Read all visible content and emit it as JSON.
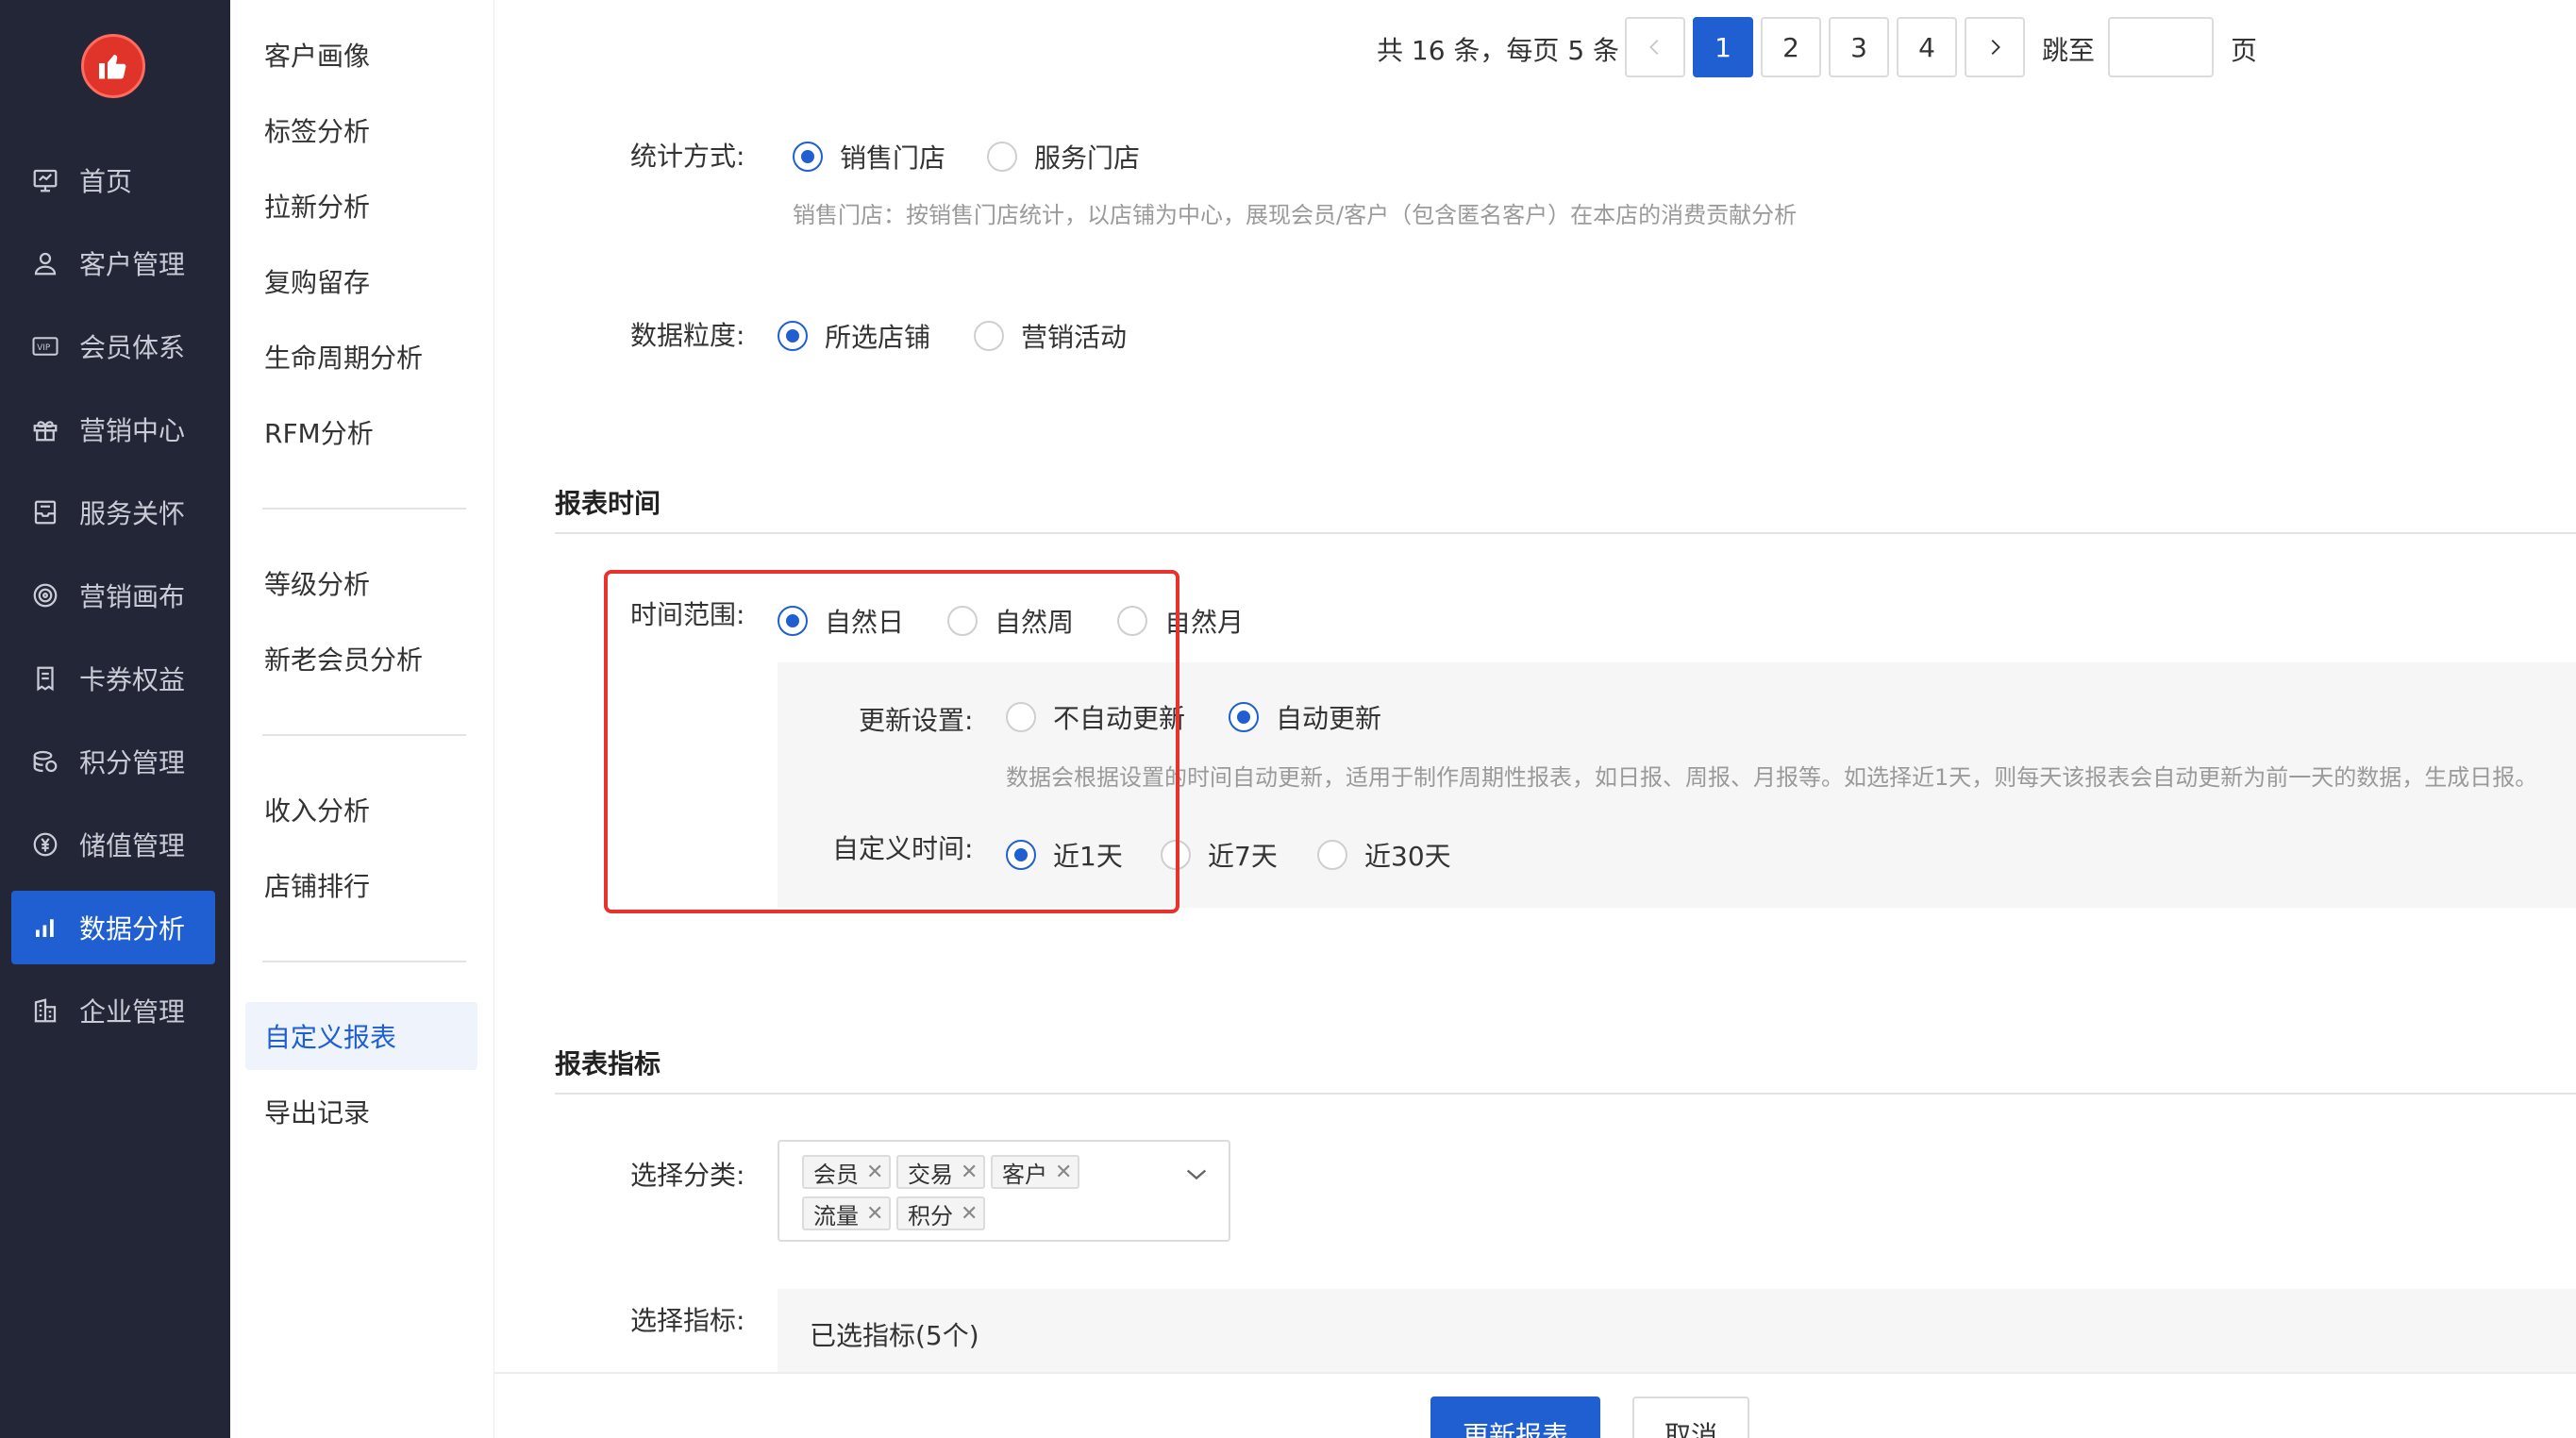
{
  "nav": {
    "logo": "thumbs-up-logo",
    "items": [
      {
        "label": "首页",
        "icon": "dashboard-icon"
      },
      {
        "label": "客户管理",
        "icon": "user-icon"
      },
      {
        "label": "会员体系",
        "icon": "vip-card-icon"
      },
      {
        "label": "营销中心",
        "icon": "gift-icon"
      },
      {
        "label": "服务关怀",
        "icon": "inbox-icon"
      },
      {
        "label": "营销画布",
        "icon": "target-icon"
      },
      {
        "label": "卡券权益",
        "icon": "coupon-icon"
      },
      {
        "label": "积分管理",
        "icon": "coins-icon"
      },
      {
        "label": "储值管理",
        "icon": "yen-icon"
      },
      {
        "label": "数据分析",
        "icon": "bar-chart-icon",
        "active": true
      },
      {
        "label": "企业管理",
        "icon": "building-icon"
      }
    ]
  },
  "submenu": {
    "items": [
      "客户画像",
      "标签分析",
      "拉新分析",
      "复购留存",
      "生命周期分析",
      "RFM分析",
      "等级分析",
      "新老会员分析",
      "收入分析",
      "店铺排行",
      "自定义报表",
      "导出记录"
    ],
    "active": "自定义报表"
  },
  "pager": {
    "summary": "共 16 条，每页 5 条",
    "pages": [
      "1",
      "2",
      "3",
      "4"
    ],
    "current": "1",
    "jump_label": "跳至",
    "page_suffix": "页",
    "prev_icon": "chevron-left-icon",
    "next_icon": "chevron-right-icon"
  },
  "stat_method": {
    "label": "统计方式:",
    "options": [
      "销售门店",
      "服务门店"
    ],
    "selected": "销售门店",
    "hint": "销售门店：按销售门店统计，以店铺为中心，展现会员/客户（包含匿名客户）在本店的消费贡献分析"
  },
  "granularity": {
    "label": "数据粒度:",
    "options": [
      "所选店铺",
      "营销活动"
    ],
    "selected": "所选店铺"
  },
  "report_time": {
    "title": "报表时间",
    "range_label": "时间范围:",
    "range_options": [
      "自然日",
      "自然周",
      "自然月"
    ],
    "range_selected": "自然日",
    "update_label": "更新设置:",
    "update_options": [
      "不自动更新",
      "自动更新"
    ],
    "update_selected": "自动更新",
    "update_hint": "数据会根据设置的时间自动更新，适用于制作周期性报表，如日报、周报、月报等。如选择近1天，则每天该报表会自动更新为前一天的数据，生成日报。",
    "custom_label": "自定义时间:",
    "custom_options": [
      "近1天",
      "近7天",
      "近30天"
    ],
    "custom_selected": "近1天",
    "highlight_color": "#e8322b"
  },
  "report_metrics": {
    "title": "报表指标",
    "category_label": "选择分类:",
    "tags": [
      "会员",
      "交易",
      "客户",
      "流量",
      "积分"
    ],
    "dropdown_icon": "chevron-down-icon",
    "close_icon": "close-icon",
    "metric_label": "选择指标:",
    "selected_metrics": "已选指标(5个)"
  },
  "footer": {
    "update_button": "更新报表",
    "cancel_button": "取消"
  },
  "colors": {
    "nav_bg": "#232636",
    "accent": "#1f5fd1",
    "highlight": "#e8322b"
  }
}
